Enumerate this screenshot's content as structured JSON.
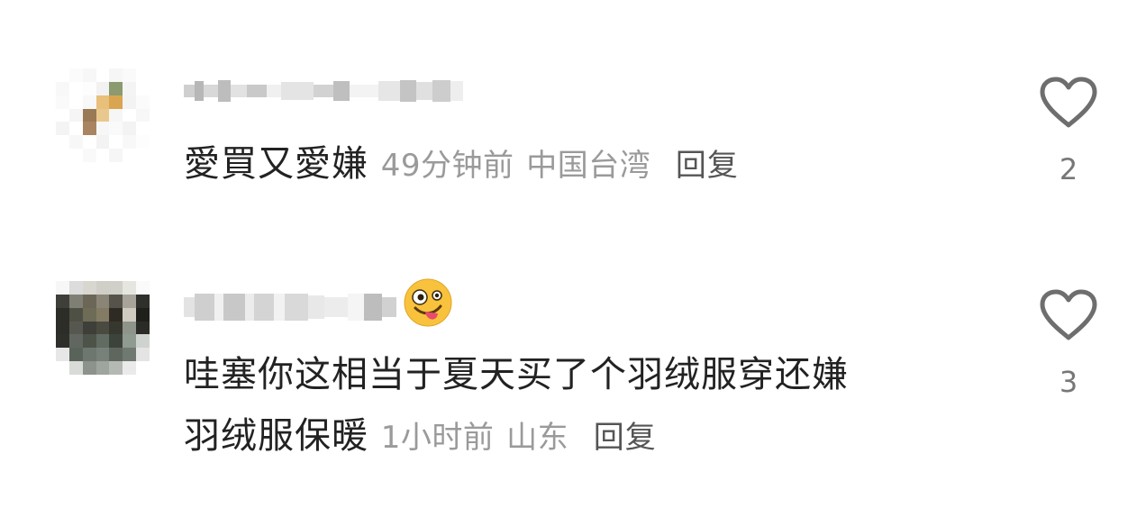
{
  "comments": [
    {
      "text": "愛買又愛嫌",
      "time": "49分钟前",
      "location": "中国台湾",
      "reply_label": "回复",
      "like_count": "2"
    },
    {
      "text_line1": "哇塞你这相当于夏天买了个羽绒服穿还嫌",
      "text_line2": "羽绒服保暖",
      "time": "1小时前",
      "location": "山东",
      "reply_label": "回复",
      "like_count": "3"
    }
  ],
  "icons": {
    "like": "heart-outline-icon",
    "name_emoji": "zany-face-emoji"
  },
  "colors": {
    "text": "#222222",
    "meta": "#9a9a9a",
    "reply": "#555555",
    "icon": "#6e6e6e"
  }
}
